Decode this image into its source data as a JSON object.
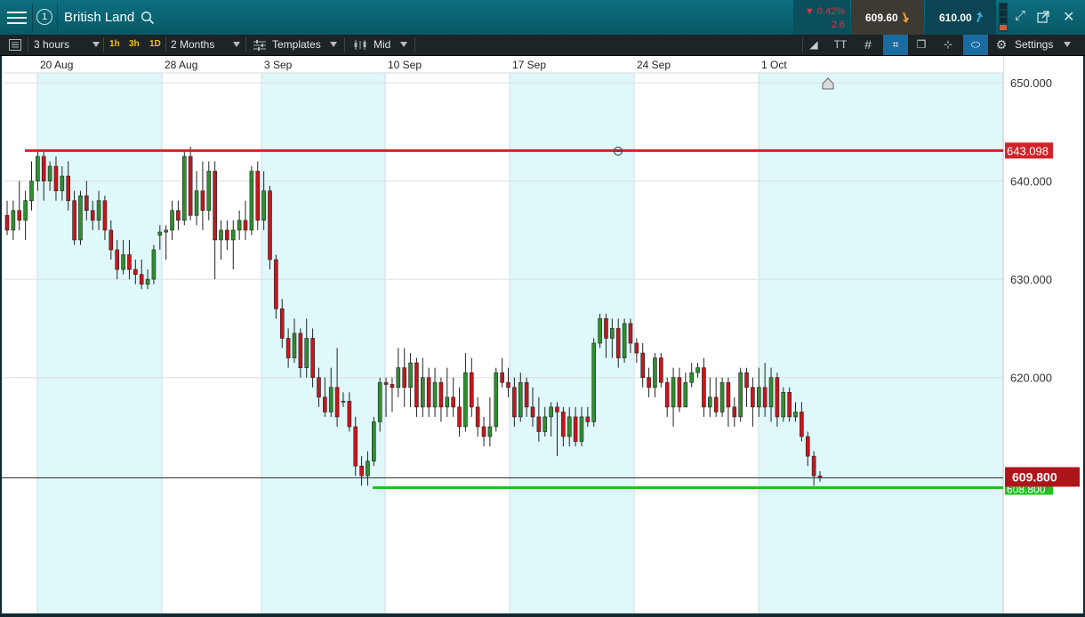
{
  "header": {
    "instrument": "British Land",
    "workspace_number": "1",
    "change_pct": "▼ 0.42%",
    "change_abs": "2.6",
    "sell_price": "609.60",
    "buy_price": "610.00"
  },
  "toolbar": {
    "interval": "3 hours",
    "quick_intervals": [
      "1h",
      "3h",
      "1D"
    ],
    "range": "2 Months",
    "templates": "Templates",
    "price_type": "Mid",
    "settings": "Settings"
  },
  "chart_data": {
    "type": "candlestick",
    "instrument": "British Land",
    "x_tick_labels": [
      "20 Aug",
      "28 Aug",
      "3 Sep",
      "10 Sep",
      "17 Sep",
      "24 Sep",
      "1 Oct"
    ],
    "y_tick_labels": [
      "650.000",
      "640.000",
      "630.000",
      "620.000"
    ],
    "ylim": [
      596,
      651
    ],
    "grid": true,
    "resistance_line": {
      "value": 643.098,
      "label": "643.098",
      "color": "#d2232a"
    },
    "support_line": {
      "value": 608.8,
      "label": "608.800",
      "color": "#1fc21f"
    },
    "current_price": {
      "value": 609.8,
      "label": "609.800",
      "color": "#b0141b"
    },
    "up_color": "#2f8f2f",
    "down_color": "#c8161d",
    "candles": [
      [
        636.5,
        635.0,
        638,
        634.5
      ],
      [
        635.0,
        637.0,
        638,
        634
      ],
      [
        637.0,
        636.0,
        640,
        635
      ],
      [
        636.0,
        638.0,
        639,
        634
      ],
      [
        638.0,
        640.0,
        642,
        637
      ],
      [
        640.0,
        642.5,
        643,
        639
      ],
      [
        642.5,
        640.0,
        643,
        638
      ],
      [
        640.0,
        641.5,
        642,
        639
      ],
      [
        641.5,
        639.0,
        642.5,
        638
      ],
      [
        639.0,
        640.5,
        641.5,
        638
      ],
      [
        640.5,
        638.0,
        642,
        637
      ],
      [
        638.0,
        634.0,
        639,
        633.5
      ],
      [
        634.0,
        638.5,
        639,
        633.5
      ],
      [
        638.5,
        637.0,
        640,
        636
      ],
      [
        637.0,
        636.0,
        638,
        635
      ],
      [
        636.0,
        638.0,
        639,
        635
      ],
      [
        638.0,
        635.0,
        638.5,
        634
      ],
      [
        635.0,
        633.0,
        636,
        632
      ],
      [
        633.0,
        631.0,
        634,
        630
      ],
      [
        631.0,
        632.5,
        634,
        630.5
      ],
      [
        632.5,
        631.0,
        634,
        630
      ],
      [
        631.0,
        630.5,
        632,
        629.5
      ],
      [
        630.5,
        629.5,
        632,
        629
      ],
      [
        629.5,
        630.0,
        631,
        629
      ],
      [
        630.0,
        633.0,
        633.5,
        629.5
      ],
      [
        634.5,
        634.8,
        635.5,
        633
      ],
      [
        634.8,
        635.0,
        635.5,
        632
      ],
      [
        635.0,
        637.0,
        638,
        634
      ],
      [
        637.0,
        636.0,
        638,
        635
      ],
      [
        636.0,
        642.5,
        643,
        635.5
      ],
      [
        642.5,
        636.5,
        643.5,
        636
      ],
      [
        636.5,
        639.0,
        641,
        635.5
      ],
      [
        639.0,
        637.0,
        642,
        635
      ],
      [
        637.0,
        641.0,
        642,
        636
      ],
      [
        641.0,
        634.0,
        642,
        630
      ],
      [
        634.0,
        635.0,
        636,
        632
      ],
      [
        635.0,
        634.0,
        636,
        633
      ],
      [
        634.0,
        635.0,
        636,
        631
      ],
      [
        635.0,
        636.0,
        637,
        634
      ],
      [
        636.0,
        635.0,
        638,
        634
      ],
      [
        635.0,
        641.0,
        641.5,
        634.5
      ],
      [
        641.0,
        636.0,
        642,
        635
      ],
      [
        636.0,
        639.0,
        641,
        635
      ],
      [
        639.0,
        632.0,
        639.5,
        631
      ],
      [
        632.0,
        627.0,
        632.5,
        626
      ],
      [
        627.0,
        624.0,
        628,
        623
      ],
      [
        624.0,
        622.0,
        625,
        621
      ],
      [
        622.0,
        624.5,
        626,
        621.5
      ],
      [
        624.5,
        621.0,
        625,
        620
      ],
      [
        621.0,
        624.0,
        626,
        620
      ],
      [
        624.0,
        620.0,
        625,
        619
      ],
      [
        620.0,
        618.0,
        621,
        617
      ],
      [
        618.0,
        616.5,
        620,
        616
      ],
      [
        616.5,
        619.0,
        621,
        616
      ],
      [
        619.0,
        616.0,
        623,
        615
      ],
      [
        617.5,
        617.6,
        618.5,
        617
      ],
      [
        617.6,
        615.0,
        618.5,
        614.5
      ],
      [
        615.0,
        611.0,
        616,
        610
      ],
      [
        611.0,
        610.0,
        612,
        609
      ],
      [
        610.0,
        611.5,
        612.5,
        609
      ],
      [
        611.5,
        615.5,
        616,
        611
      ],
      [
        615.5,
        619.5,
        620,
        614.5
      ],
      [
        619.5,
        619.3,
        620,
        616
      ],
      [
        619.3,
        619.0,
        620,
        616.5
      ],
      [
        619.0,
        621.0,
        623,
        618
      ],
      [
        621.0,
        619.0,
        623,
        617
      ],
      [
        619.0,
        621.5,
        622.5,
        617
      ],
      [
        621.5,
        617.0,
        622,
        616
      ],
      [
        617.0,
        620.0,
        622,
        616
      ],
      [
        620.0,
        617.0,
        621,
        616
      ],
      [
        617.0,
        619.5,
        621,
        616
      ],
      [
        619.5,
        617.0,
        620,
        615.5
      ],
      [
        617.0,
        618.0,
        621,
        616
      ],
      [
        618.0,
        617.0,
        620,
        616
      ],
      [
        617.0,
        615.0,
        619,
        614
      ],
      [
        615.0,
        620.5,
        622.5,
        614.5
      ],
      [
        620.5,
        617.0,
        622,
        616
      ],
      [
        617.0,
        615.0,
        618,
        614
      ],
      [
        615.0,
        614.0,
        616,
        613
      ],
      [
        614.0,
        615.0,
        618,
        613
      ],
      [
        615.0,
        620.5,
        621,
        614.5
      ],
      [
        620.5,
        619.5,
        622,
        619
      ],
      [
        619.5,
        619.0,
        621,
        618
      ],
      [
        619.0,
        616.0,
        620,
        615
      ],
      [
        616.0,
        619.5,
        620.5,
        615.5
      ],
      [
        619.5,
        617.0,
        620,
        616
      ],
      [
        617.0,
        616.0,
        619,
        615
      ],
      [
        616.0,
        614.5,
        618,
        613.5
      ],
      [
        614.5,
        616.0,
        617,
        614
      ],
      [
        616.0,
        617.0,
        617.5,
        614
      ],
      [
        617.0,
        616.5,
        617.5,
        612
      ],
      [
        616.5,
        614.0,
        617,
        613
      ],
      [
        614.0,
        616.0,
        617,
        613
      ],
      [
        616.0,
        613.5,
        617,
        613
      ],
      [
        613.5,
        616.0,
        617,
        613
      ],
      [
        616.0,
        615.5,
        617,
        615
      ],
      [
        615.5,
        623.5,
        624,
        615
      ],
      [
        623.5,
        626.0,
        626.5,
        623
      ],
      [
        626.0,
        624.0,
        626.5,
        622
      ],
      [
        624.0,
        625.0,
        626,
        622
      ],
      [
        625.0,
        622.0,
        626,
        621
      ],
      [
        622.0,
        625.5,
        626,
        621.5
      ],
      [
        625.5,
        623.5,
        626,
        622.5
      ],
      [
        623.5,
        622.5,
        624,
        621.5
      ],
      [
        622.5,
        620.0,
        623.5,
        619
      ],
      [
        620.0,
        619.0,
        621,
        618
      ],
      [
        619.0,
        622.0,
        622.5,
        618
      ],
      [
        622.0,
        619.5,
        622.5,
        619
      ],
      [
        619.5,
        617.0,
        620,
        616
      ],
      [
        617.0,
        620.0,
        621,
        615
      ],
      [
        620.0,
        617.0,
        621,
        616.5
      ],
      [
        617.0,
        619.5,
        620.5,
        617
      ],
      [
        619.5,
        620.5,
        621.5,
        619
      ],
      [
        620.5,
        621.0,
        621.5,
        620
      ],
      [
        621.0,
        617.0,
        622,
        616
      ],
      [
        617.0,
        618.0,
        620,
        616
      ],
      [
        618.0,
        616.5,
        620,
        616
      ],
      [
        616.5,
        619.5,
        620,
        616
      ],
      [
        619.5,
        617.0,
        620,
        615
      ],
      [
        617.0,
        616.0,
        618,
        615
      ],
      [
        616.0,
        620.5,
        621,
        615.5
      ],
      [
        620.5,
        619.0,
        621,
        617
      ],
      [
        619.0,
        617.0,
        620,
        615
      ],
      [
        617.0,
        619.0,
        621,
        616
      ],
      [
        619.0,
        617.0,
        621.5,
        616
      ],
      [
        617.0,
        620.0,
        621,
        615.5
      ],
      [
        620.0,
        616.0,
        620.5,
        615
      ],
      [
        616.0,
        618.5,
        619,
        615.5
      ],
      [
        618.5,
        616.0,
        619,
        615.5
      ],
      [
        616.0,
        616.5,
        617.5,
        615.5
      ],
      [
        616.5,
        614.0,
        617.5,
        613.5
      ],
      [
        614.0,
        612.0,
        614.5,
        611
      ],
      [
        612.0,
        610.0,
        612.5,
        609
      ],
      [
        610.0,
        609.8,
        610.5,
        609.4
      ]
    ]
  }
}
